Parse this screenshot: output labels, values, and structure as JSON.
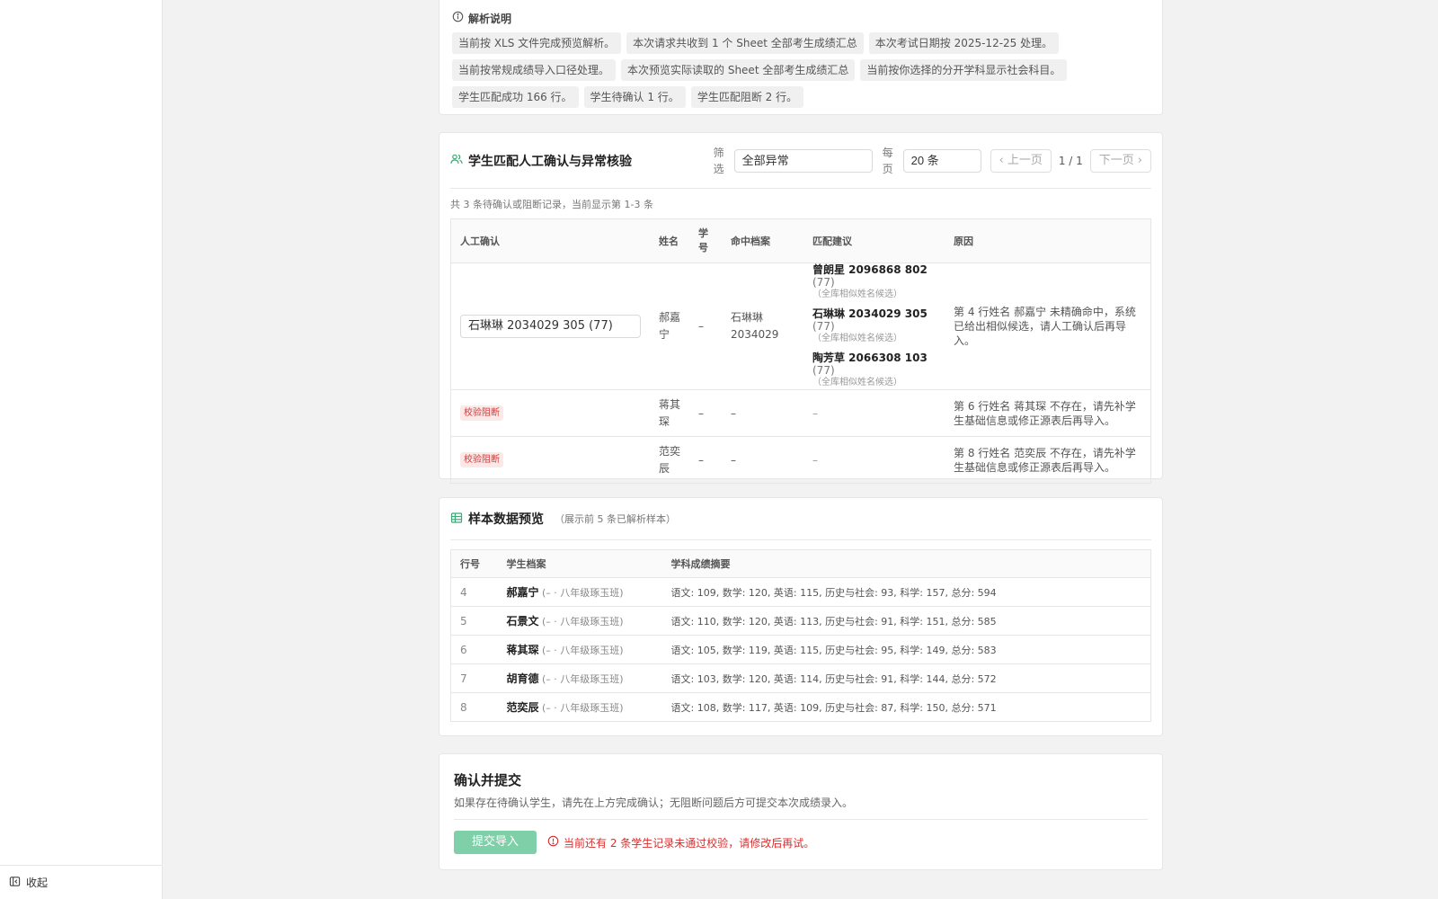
{
  "sidebar": {
    "collapse_label": "收起"
  },
  "parse_notes": {
    "title": "解析说明",
    "chips": [
      "当前按 XLS 文件完成预览解析。",
      "本次请求共收到 1 个 Sheet 全部考生成绩汇总",
      "本次考试日期按 2025-12-25 处理。",
      "当前按常规成绩导入口径处理。",
      "本次预览实际读取的 Sheet 全部考生成绩汇总",
      "当前按你选择的分开学科显示社会科目。",
      "学生匹配成功 166 行。",
      "学生待确认 1 行。",
      "学生匹配阻断 2 行。"
    ]
  },
  "match": {
    "title": "学生匹配人工确认与异常核验",
    "filter_label": "筛选",
    "filter_value": "全部异常",
    "per_page_label": "每页",
    "per_page_value": "20 条",
    "prev_label": "上一页",
    "page_info": "1 / 1",
    "next_label": "下一页",
    "summary": "共 3 条待确认或阻断记录，当前显示第 1-3 条",
    "headers": [
      "人工确认",
      "姓名",
      "学号",
      "命中档案",
      "匹配建议",
      "原因"
    ],
    "rows": [
      {
        "confirm": "石琳琳 2034029 305 (77)",
        "name": "郝嘉宁",
        "sid": "–",
        "hit": "石琳琳 2034029",
        "suggestions": [
          {
            "name": "曾朗星 2096868 802",
            "score": "(77)",
            "note": "（全库相似姓名候选）"
          },
          {
            "name": "石琳琳 2034029 305",
            "score": "(77)",
            "note": "（全库相似姓名候选）"
          },
          {
            "name": "陶芳草 2066308 103",
            "score": "(77)",
            "note": "（全库相似姓名候选）"
          }
        ],
        "reason": "第 4 行姓名 郝嘉宁 未精确命中，系统已给出相似候选，请人工确认后再导入。"
      },
      {
        "badge": "校验阻断",
        "name": "蒋其琛",
        "sid": "–",
        "hit": "–",
        "suggestion_text": "–",
        "reason": "第 6 行姓名 蒋其琛 不存在，请先补学生基础信息或修正源表后再导入。"
      },
      {
        "badge": "校验阻断",
        "name": "范奕辰",
        "sid": "–",
        "hit": "–",
        "suggestion_text": "–",
        "reason": "第 8 行姓名 范奕辰 不存在，请先补学生基础信息或修正源表后再导入。"
      }
    ]
  },
  "sample": {
    "title": "样本数据预览",
    "subtitle": "（展示前 5 条已解析样本）",
    "headers": [
      "行号",
      "学生档案",
      "学科成绩摘要"
    ],
    "rows": [
      {
        "row": "4",
        "name": "郝嘉宁",
        "cls": "(– · 八年级琢玉班)",
        "summary": "语文: 109,  数学: 120,  英语: 115,  历史与社会: 93,  科学: 157,  总分: 594"
      },
      {
        "row": "5",
        "name": "石景文",
        "cls": "(– · 八年级琢玉班)",
        "summary": "语文: 110,  数学: 120,  英语: 113,  历史与社会: 91,  科学: 151,  总分: 585"
      },
      {
        "row": "6",
        "name": "蒋其琛",
        "cls": "(– · 八年级琢玉班)",
        "summary": "语文: 105,  数学: 119,  英语: 115,  历史与社会: 95,  科学: 149,  总分: 583"
      },
      {
        "row": "7",
        "name": "胡育德",
        "cls": "(– · 八年级琢玉班)",
        "summary": "语文: 103,  数学: 120,  英语: 114,  历史与社会: 91,  科学: 144,  总分: 572"
      },
      {
        "row": "8",
        "name": "范奕辰",
        "cls": "(– · 八年级琢玉班)",
        "summary": "语文: 108,  数学: 117,  英语: 109,  历史与社会: 87,  科学: 150,  总分: 571"
      }
    ]
  },
  "submit": {
    "title": "确认并提交",
    "desc": "如果存在待确认学生，请先在上方完成确认；无阻断问题后方可提交本次成绩录入。",
    "button": "提交导入",
    "error": "当前还有 2 条学生记录未通过校验，请修改后再试。"
  },
  "colors": {
    "accent": "#3fa876",
    "button": "#7fcfa8",
    "error": "#d62f2f"
  }
}
